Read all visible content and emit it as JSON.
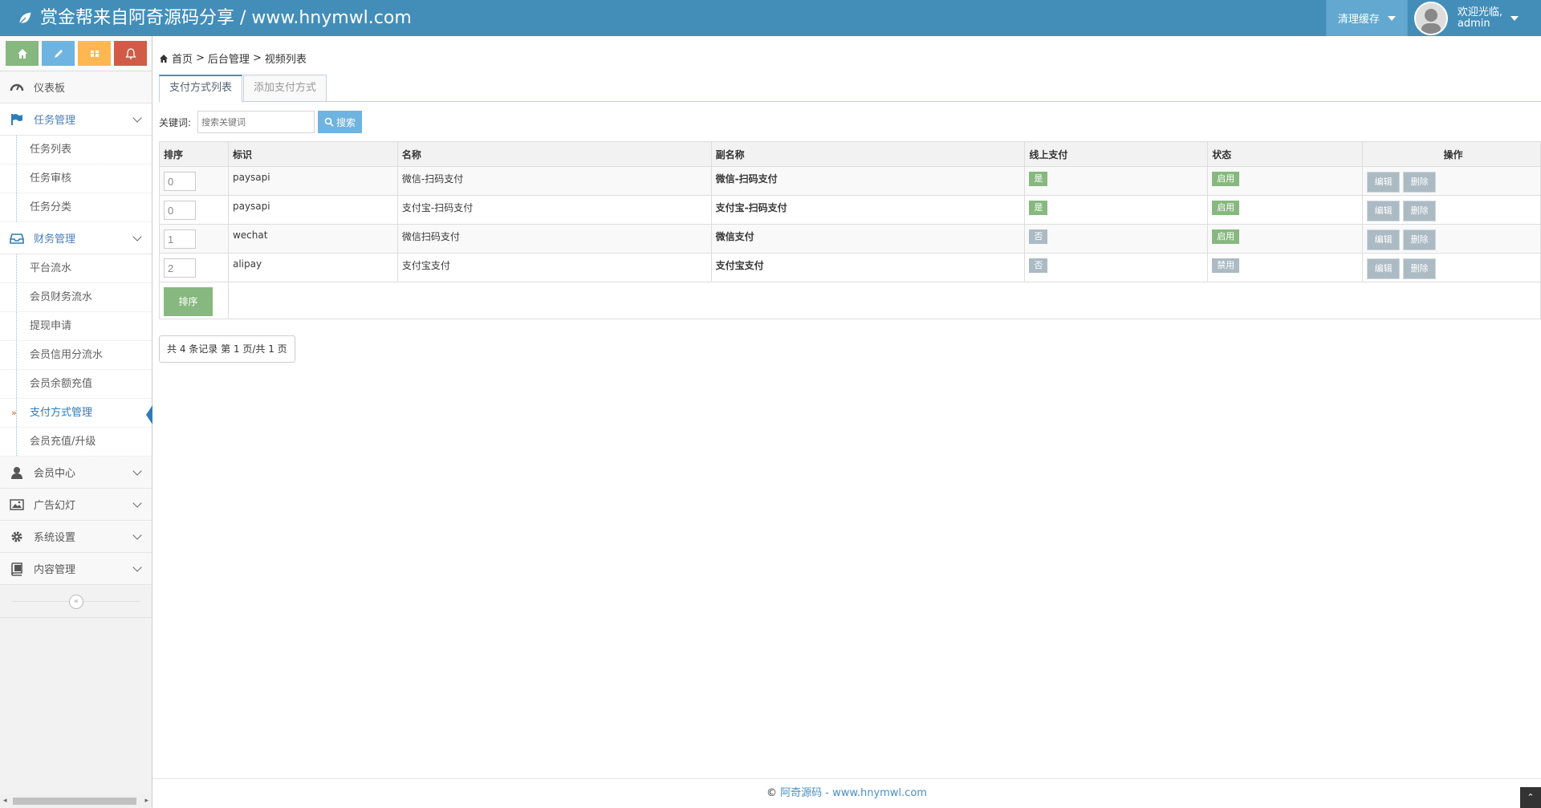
{
  "brand": {
    "title": "赏金帮来自阿奇源码分享 / www.hnymwl.com"
  },
  "topbar": {
    "clear_cache": "清理缓存",
    "welcome": "欢迎光临,",
    "username": "admin"
  },
  "sidebar": {
    "dashboard": "仪表板",
    "task_mgmt": "任务管理",
    "task_items": [
      "任务列表",
      "任务审核",
      "任务分类"
    ],
    "finance_mgmt": "财务管理",
    "finance_items": [
      "平台流水",
      "会员财务流水",
      "提现申请",
      "会员信用分流水",
      "会员余额充值",
      "支付方式管理",
      "会员充值/升级"
    ],
    "member_center": "会员中心",
    "ads": "广告幻灯",
    "system": "系统设置",
    "content": "内容管理",
    "collapse": "«"
  },
  "breadcrumb": {
    "home": "首页",
    "sep": ">",
    "backend": "后台管理",
    "current": "视频列表"
  },
  "tabs": [
    "支付方式列表",
    "添加支付方式"
  ],
  "search": {
    "label": "关键词:",
    "placeholder": "搜索关键词",
    "button": "搜索"
  },
  "table": {
    "headers": [
      "排序",
      "标识",
      "名称",
      "副名称",
      "线上支付",
      "状态",
      "操作"
    ],
    "rows": [
      {
        "sort": "0",
        "code": "paysapi",
        "name": "微信-扫码支付",
        "subname": "微信-扫码支付",
        "online": "是",
        "status": "启用"
      },
      {
        "sort": "0",
        "code": "paysapi",
        "name": "支付宝-扫码支付",
        "subname": "支付宝-扫码支付",
        "online": "是",
        "status": "启用"
      },
      {
        "sort": "1",
        "code": "wechat",
        "name": "微信扫码支付",
        "subname": "微信支付",
        "online": "否",
        "status": "启用"
      },
      {
        "sort": "2",
        "code": "alipay",
        "name": "支付宝支付",
        "subname": "支付宝支付",
        "online": "否",
        "status": "禁用"
      }
    ],
    "edit": "编辑",
    "delete": "删除",
    "sort_button": "排序"
  },
  "pager": {
    "text": "共 4 条记录 第 1 页/共 1 页"
  },
  "footer": {
    "copyright": "©",
    "link": "阿奇源码 - www.hnymwl.com"
  },
  "colors": {
    "primary": "#438eb9",
    "green": "#87b87f",
    "gray": "#abbac3",
    "red": "#d15b47",
    "orange": "#ffb752",
    "blue": "#6fb3e0"
  }
}
